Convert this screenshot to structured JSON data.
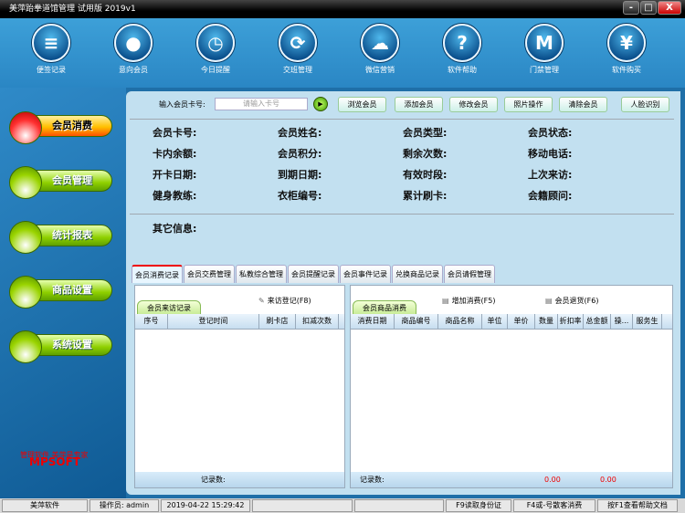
{
  "window": {
    "title": "美萍跆拳道馆管理 试用版 2019v1",
    "min": "-",
    "max": "□",
    "close": "X"
  },
  "toolbar": [
    {
      "label": "便签记录",
      "icon": "note-icon",
      "glyph": "≡"
    },
    {
      "label": "意向会员",
      "icon": "user-icon",
      "glyph": "●"
    },
    {
      "label": "今日提醒",
      "icon": "clock-icon",
      "glyph": "◷"
    },
    {
      "label": "交班管理",
      "icon": "refresh-icon",
      "glyph": "⟳"
    },
    {
      "label": "微信营销",
      "icon": "wechat-icon",
      "glyph": "☁"
    },
    {
      "label": "软件帮助",
      "icon": "help-icon",
      "glyph": "?"
    },
    {
      "label": "门禁管理",
      "icon": "m-icon",
      "glyph": "M"
    },
    {
      "label": "软件购买",
      "icon": "yen-icon",
      "glyph": "¥"
    }
  ],
  "sidebar": [
    {
      "label": "会员消费"
    },
    {
      "label": "会员管理"
    },
    {
      "label": "统计报表"
    },
    {
      "label": "商品设置"
    },
    {
      "label": "系统设置"
    }
  ],
  "logo": {
    "brand": "MPSOFT",
    "slogan": "管理软件 美萍是专家"
  },
  "search": {
    "label": "输入会员卡号:",
    "placeholder": "请输入卡号",
    "go": "▶"
  },
  "actions": [
    "浏览会员",
    "添加会员",
    "修改会员",
    "照片操作",
    "清除会员",
    "人脸识别"
  ],
  "fields": [
    [
      "会员卡号:",
      "会员姓名:",
      "会员类型:",
      "会员状态:"
    ],
    [
      "卡内余额:",
      "会员积分:",
      "剩余次数:",
      "移动电话:"
    ],
    [
      "开卡日期:",
      "到期日期:",
      "有效时段:",
      "上次来访:"
    ],
    [
      "健身教练:",
      "衣柜编号:",
      "累计刷卡:",
      "会籍顾问:"
    ]
  ],
  "other_info": "其它信息:",
  "tabs": [
    "会员消费记录",
    "会员交费管理",
    "私教综合管理",
    "会员提醒记录",
    "会员事件记录",
    "兑换商品记录",
    "会员请假管理"
  ],
  "left_panel": {
    "subtab": "会员来访记录",
    "action": "来访登记(F8)",
    "columns": [
      "序号",
      "登记时间",
      "刷卡店",
      "扣减次数"
    ],
    "footer": "记录数:"
  },
  "right_panel": {
    "subtab": "会员商品消费",
    "add": "增加消费(F5)",
    "return": "会员退货(F6)",
    "columns": [
      "消费日期",
      "商品编号",
      "商品名称",
      "单位",
      "单价",
      "数量",
      "折扣率",
      "总金额",
      "操...",
      "服务生"
    ],
    "footer": "记录数:",
    "total1": "0.00",
    "total2": "0.00"
  },
  "status": {
    "company": "美萍软件",
    "operator": "操作员: admin",
    "datetime": "2019-04-22 15:29:42",
    "f9": "F9读取身份证",
    "f4": "F4或-号散客消费",
    "f1": "按F1查看帮助文档"
  }
}
